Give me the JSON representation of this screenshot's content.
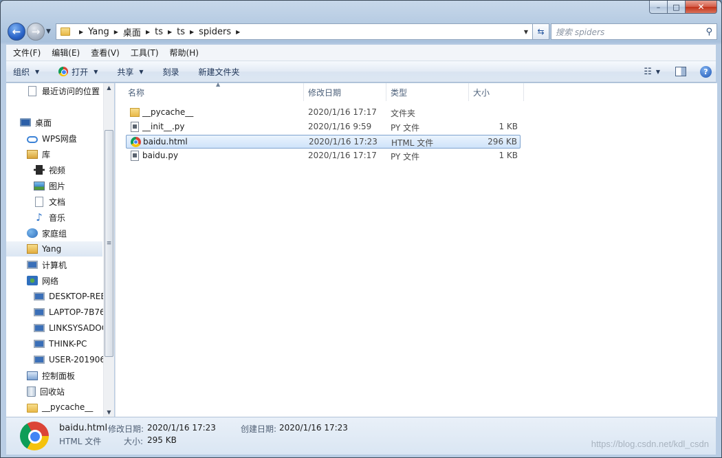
{
  "window": {
    "caption": {
      "minimize": "–",
      "maximize": "□",
      "close": "✕"
    }
  },
  "address": {
    "crumbs": [
      "Yang",
      "桌面",
      "ts",
      "ts",
      "spiders"
    ],
    "search_placeholder": "搜索 spiders"
  },
  "menu": [
    "文件(F)",
    "编辑(E)",
    "查看(V)",
    "工具(T)",
    "帮助(H)"
  ],
  "toolbar": {
    "organize": "组织",
    "open": "打开",
    "share": "共享",
    "burn": "刻录",
    "new_folder": "新建文件夹"
  },
  "nav": {
    "recent": "最近访问的位置",
    "desktop": "桌面",
    "wps": "WPS网盘",
    "library": "库",
    "video": "视频",
    "pictures": "图片",
    "documents": "文档",
    "music": "音乐",
    "homegroup": "家庭组",
    "user": "Yang",
    "computer": "计算机",
    "network": "网络",
    "net_hosts": [
      "DESKTOP-REE",
      "LAPTOP-7B76",
      "LINKSYSADOC",
      "THINK-PC",
      "USER-201906"
    ],
    "control_panel": "控制面板",
    "recycle_bin": "回收站",
    "pycache": "__pycache__"
  },
  "columns": {
    "name": "名称",
    "date": "修改日期",
    "type": "类型",
    "size": "大小"
  },
  "files": [
    {
      "name": "__pycache__",
      "date": "2020/1/16 17:17",
      "type": "文件夹",
      "size": "",
      "icon": "folder-icon"
    },
    {
      "name": "__init__.py",
      "date": "2020/1/16 9:59",
      "type": "PY 文件",
      "size": "1 KB",
      "icon": "py-file-icon"
    },
    {
      "name": "baidu.html",
      "date": "2020/1/16 17:23",
      "type": "HTML 文件",
      "size": "296 KB",
      "icon": "chrome-icon"
    },
    {
      "name": "baidu.py",
      "date": "2020/1/16 17:17",
      "type": "PY 文件",
      "size": "1 KB",
      "icon": "py-file-icon"
    }
  ],
  "details": {
    "filename": "baidu.html",
    "modified_label": "修改日期:",
    "modified": "2020/1/16 17:23",
    "created_label": "创建日期:",
    "created": "2020/1/16 17:23",
    "type": "HTML 文件",
    "size_label": "大小:",
    "size": "295 KB"
  },
  "watermark": "https://blog.csdn.net/kdl_csdn"
}
